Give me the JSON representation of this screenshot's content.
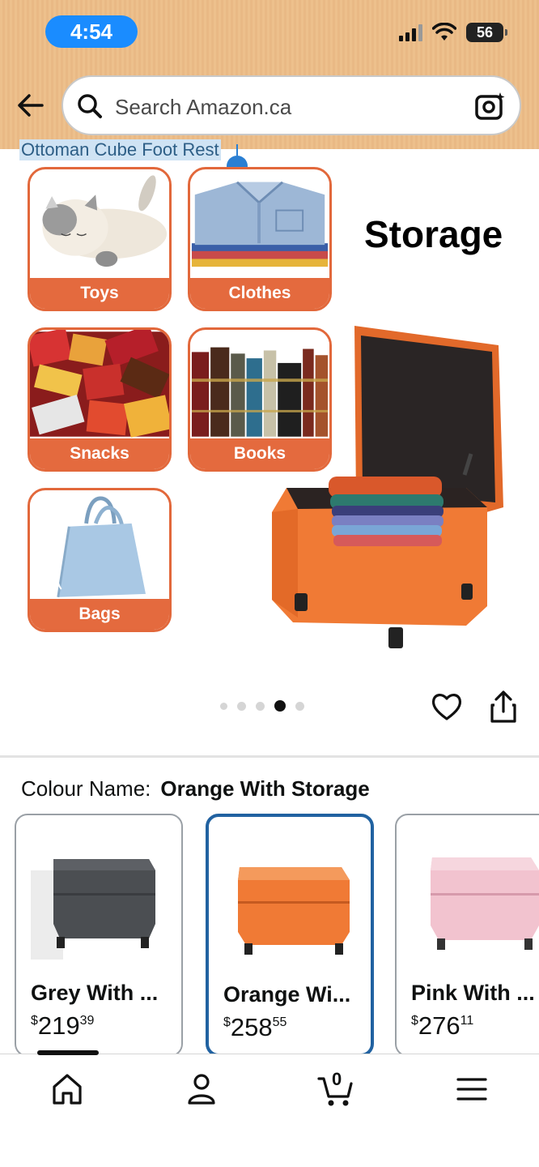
{
  "status_bar": {
    "time": "4:54",
    "battery": "56"
  },
  "search": {
    "placeholder": "Search Amazon.ca"
  },
  "product_title_snippet": "Ottoman Cube Foot Rest",
  "hero": {
    "heading": "Storage",
    "categories": [
      {
        "label": "Toys"
      },
      {
        "label": "Clothes"
      },
      {
        "label": "Snacks"
      },
      {
        "label": "Books"
      },
      {
        "label": "Bags"
      }
    ],
    "carousel": {
      "count": 5,
      "active_index": 3
    }
  },
  "colour": {
    "label": "Colour Name:",
    "value": "Orange With Storage"
  },
  "swatches": [
    {
      "name": "Grey With ...",
      "price_symbol": "$",
      "price_whole": "219",
      "price_fraction": "39",
      "selected": false,
      "color": "#4b4e52"
    },
    {
      "name": "Orange Wi...",
      "price_symbol": "$",
      "price_whole": "258",
      "price_fraction": "55",
      "selected": true,
      "color": "#f07a35"
    },
    {
      "name": "Pink With ...",
      "price_symbol": "$",
      "price_whole": "276",
      "price_fraction": "11",
      "selected": false,
      "color": "#f2c3cf"
    }
  ],
  "bottom_nav": {
    "cart_count": "0"
  },
  "colors": {
    "brand_orange": "#e46a3e",
    "selected_border": "#2162a1",
    "header_bg": "#edc08c",
    "time_pill": "#1a8cff"
  }
}
